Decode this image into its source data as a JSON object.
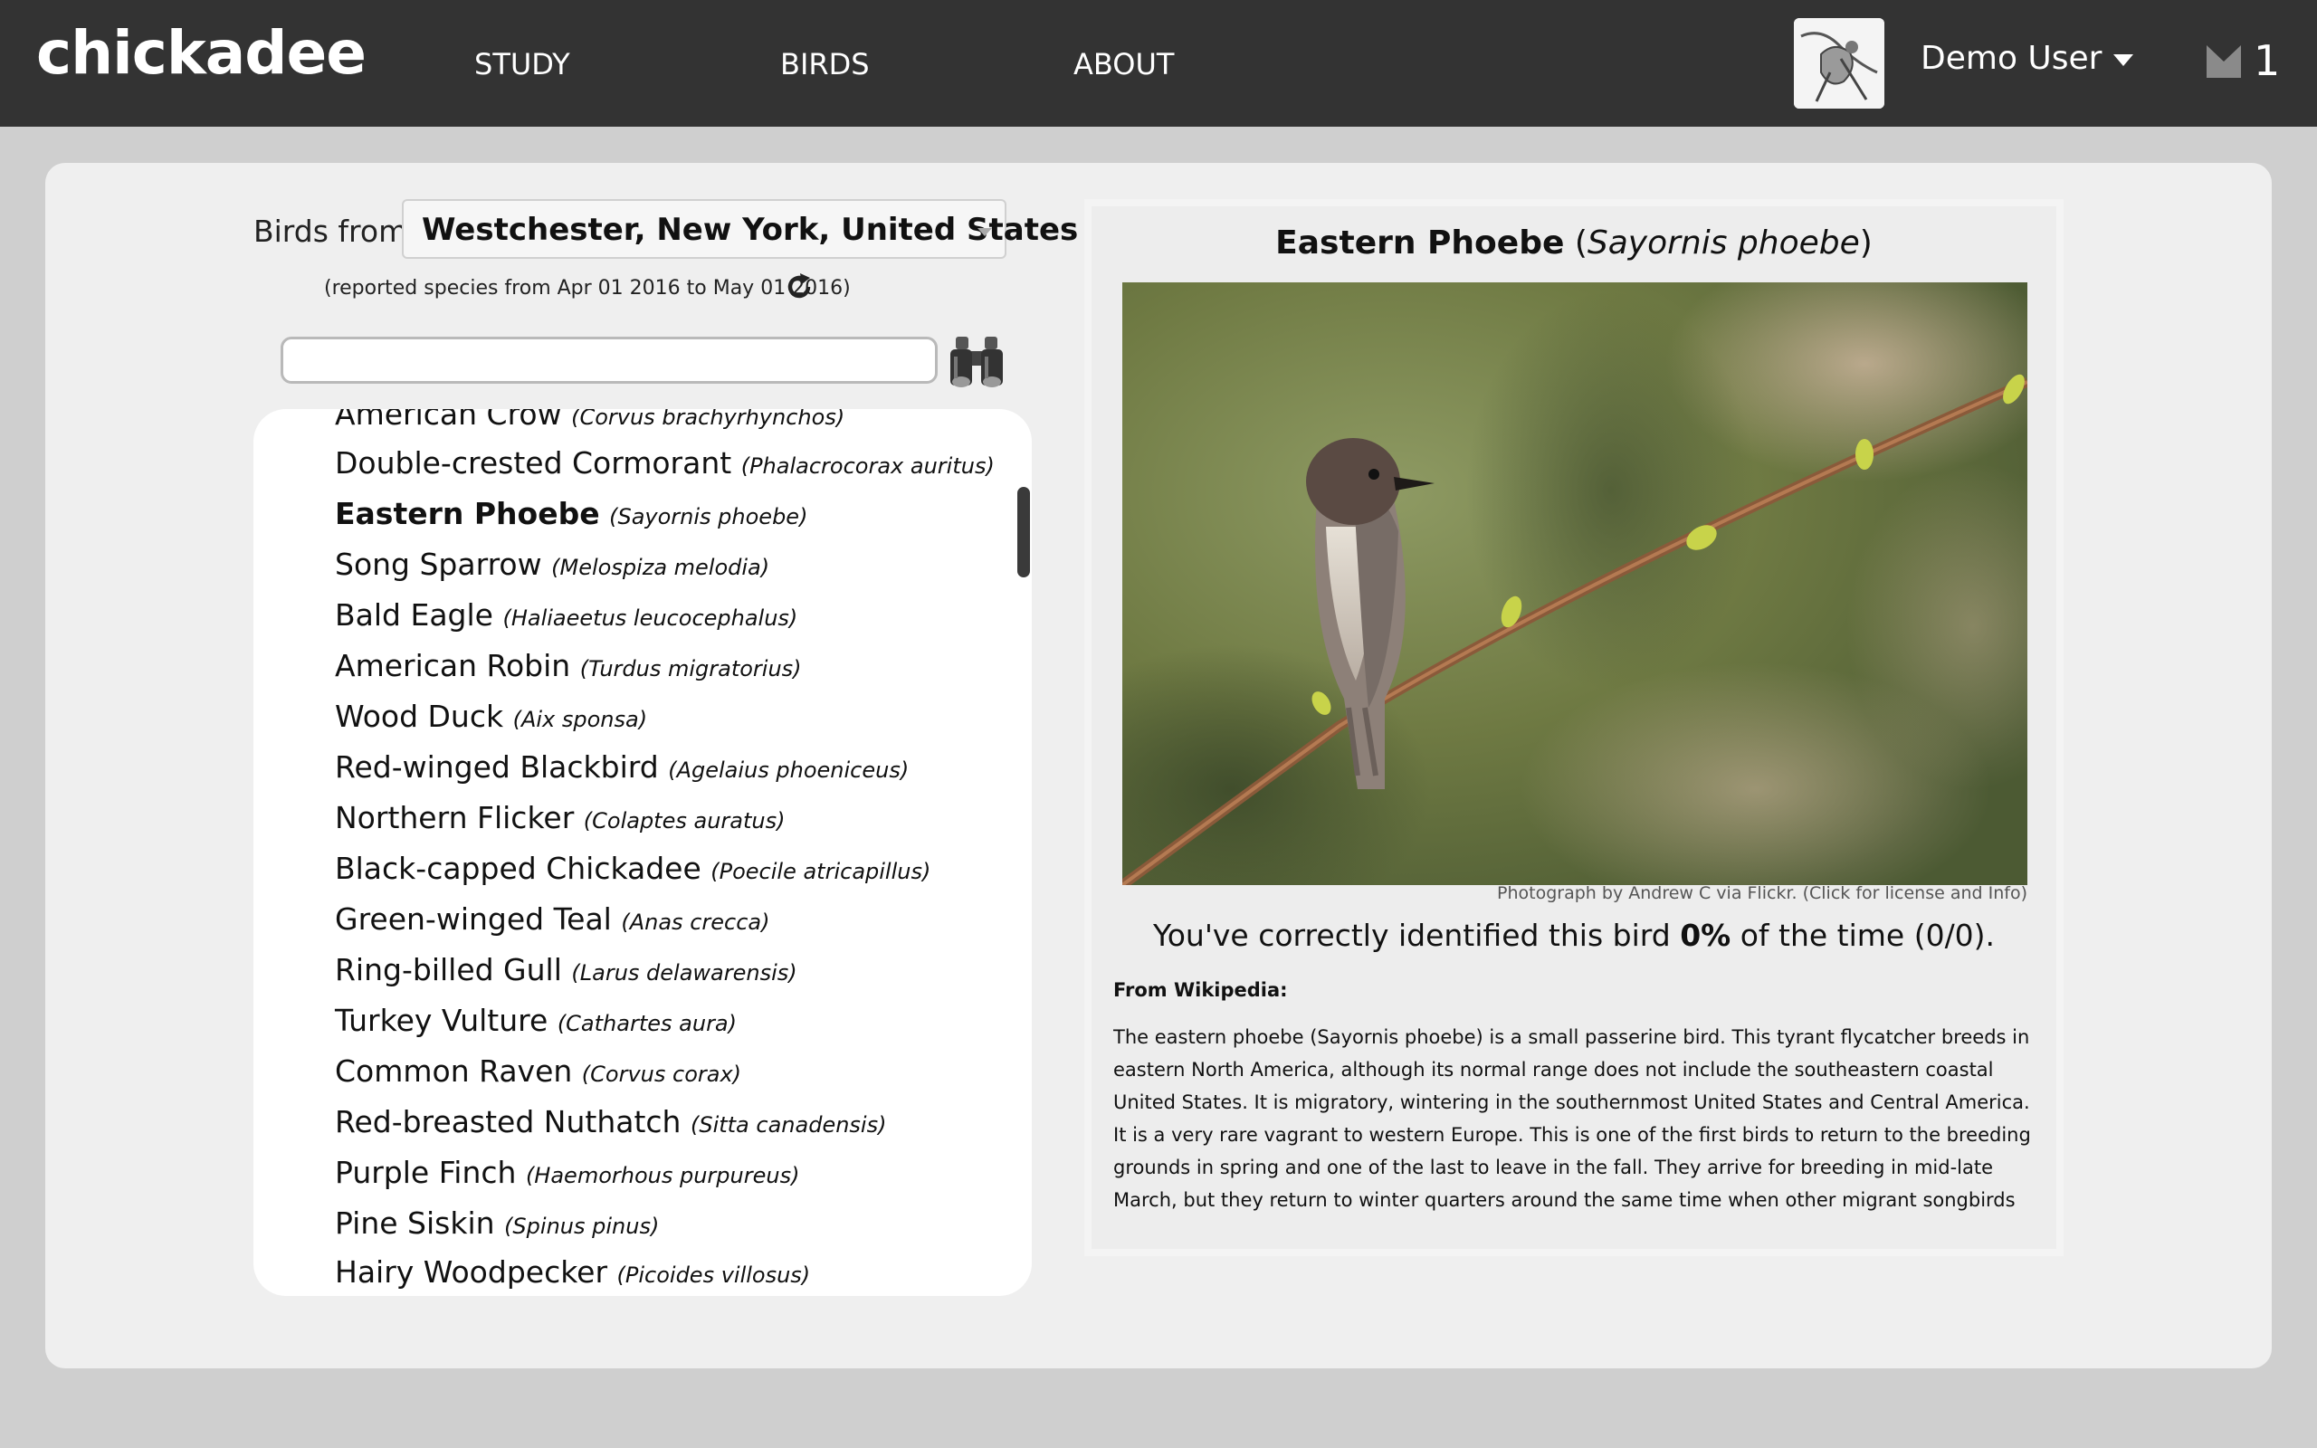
{
  "app": {
    "logo": "chickadee"
  },
  "nav": {
    "items": [
      {
        "label": "STUDY"
      },
      {
        "label": "BIRDS"
      },
      {
        "label": "ABOUT"
      }
    ]
  },
  "user": {
    "name": "Demo User",
    "notification_count": "1"
  },
  "filter": {
    "label": "Birds from",
    "location": "Westchester, New York, United States",
    "date_range": "(reported species from Apr 01 2016 to May 01 2016)"
  },
  "search": {
    "value": "",
    "placeholder": ""
  },
  "species_list": [
    {
      "common": "American Crow",
      "scientific": "(Corvus brachyrhynchos)"
    },
    {
      "common": "Double-crested Cormorant",
      "scientific": "(Phalacrocorax auritus)"
    },
    {
      "common": "Eastern Phoebe",
      "scientific": "(Sayornis phoebe)",
      "selected": true
    },
    {
      "common": "Song Sparrow",
      "scientific": "(Melospiza melodia)"
    },
    {
      "common": "Bald Eagle",
      "scientific": "(Haliaeetus leucocephalus)"
    },
    {
      "common": "American Robin",
      "scientific": "(Turdus migratorius)"
    },
    {
      "common": "Wood Duck",
      "scientific": "(Aix sponsa)"
    },
    {
      "common": "Red-winged Blackbird",
      "scientific": "(Agelaius phoeniceus)"
    },
    {
      "common": "Northern Flicker",
      "scientific": "(Colaptes auratus)"
    },
    {
      "common": "Black-capped Chickadee",
      "scientific": "(Poecile atricapillus)"
    },
    {
      "common": "Green-winged Teal",
      "scientific": "(Anas crecca)"
    },
    {
      "common": "Ring-billed Gull",
      "scientific": "(Larus delawarensis)"
    },
    {
      "common": "Turkey Vulture",
      "scientific": "(Cathartes aura)"
    },
    {
      "common": "Common Raven",
      "scientific": "(Corvus corax)"
    },
    {
      "common": "Red-breasted Nuthatch",
      "scientific": "(Sitta canadensis)"
    },
    {
      "common": "Purple Finch",
      "scientific": "(Haemorhous purpureus)"
    },
    {
      "common": "Pine Siskin",
      "scientific": "(Spinus pinus)"
    },
    {
      "common": "Hairy Woodpecker",
      "scientific": "(Picoides villosus)"
    }
  ],
  "detail": {
    "common": "Eastern Phoebe",
    "title_open": " (",
    "scientific": "Sayornis phoebe",
    "title_close": ")",
    "photo_credit": "Photograph by Andrew C via Flickr. (Click for license and Info)",
    "stat_prefix": "You've correctly identified this bird ",
    "stat_percent": "0%",
    "stat_suffix": " of the time (0/0).",
    "wiki_heading": "From Wikipedia:",
    "wiki_text": "The eastern phoebe (Sayornis phoebe) is a small passerine bird. This tyrant flycatcher breeds in eastern North America, although its normal range does not include the southeastern coastal United States. It is migratory, wintering in the southernmost United States and Central America. It is a very rare vagrant to western Europe. This is one of the first birds to return to the breeding grounds in spring and one of the last to leave in the fall. They arrive for breeding in mid-late March, but they return to winter quarters around the same time when other migrant songbirds do, in September and early October; migration"
  },
  "colors": {
    "topbar": "#333333",
    "background": "#cfcfcf",
    "panel": "#efefef"
  }
}
